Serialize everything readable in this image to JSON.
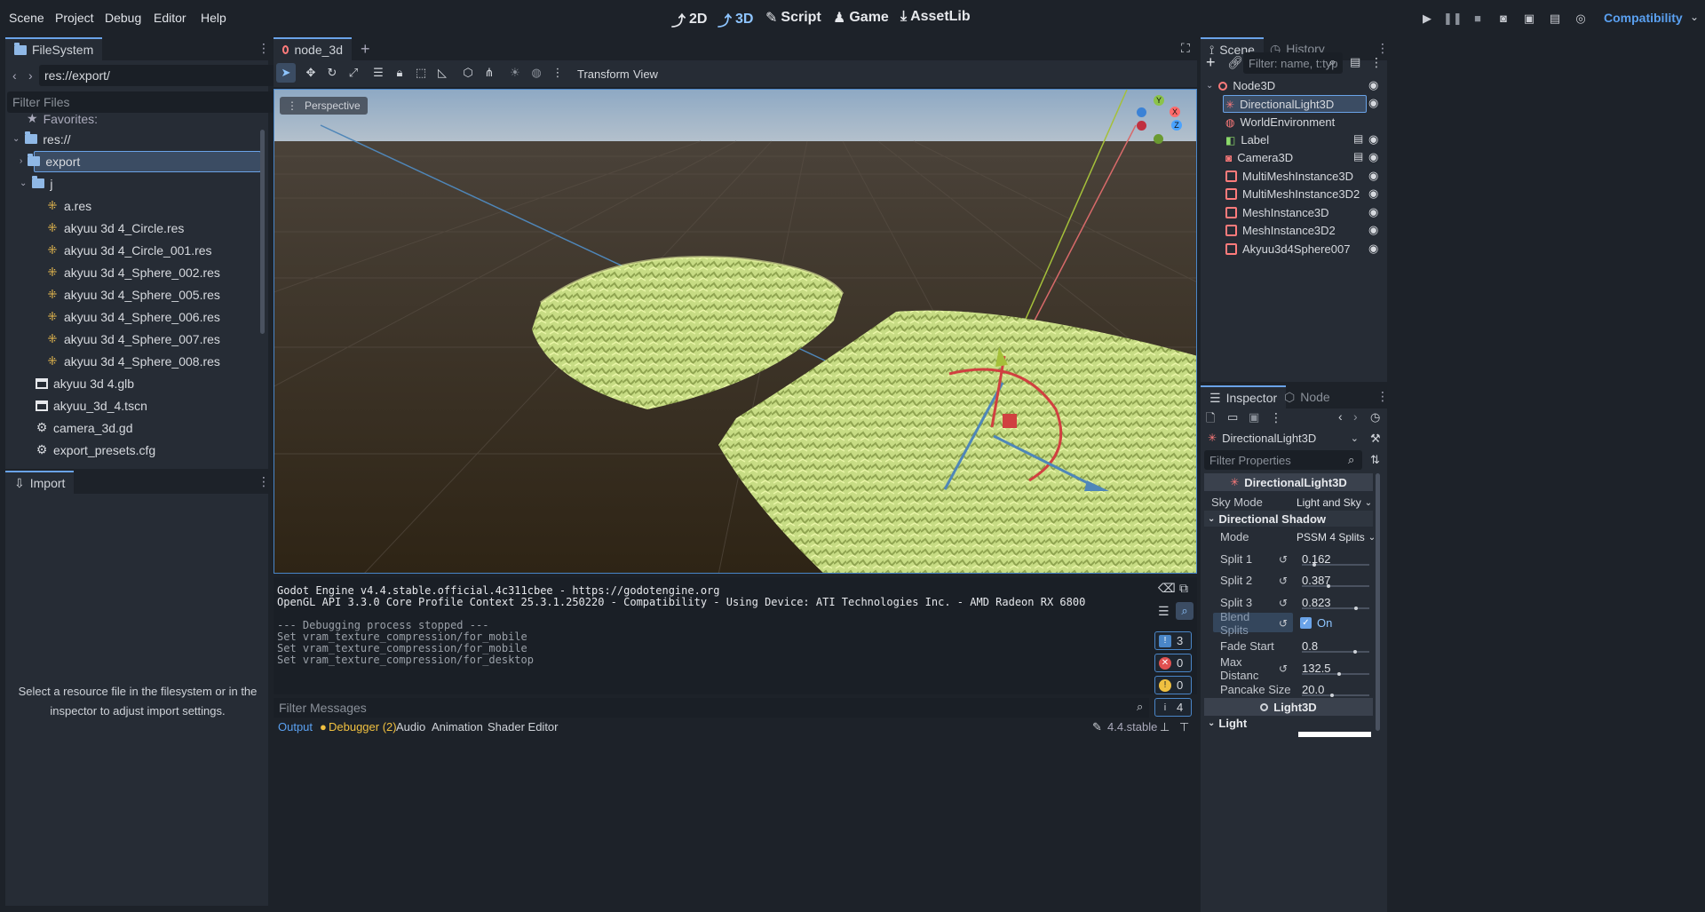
{
  "menu": {
    "scene": "Scene",
    "project": "Project",
    "debug": "Debug",
    "editor": "Editor",
    "help": "Help"
  },
  "workspaces": {
    "w2d": "2D",
    "w3d": "3D",
    "script": "Script",
    "game": "Game",
    "assetlib": "AssetLib"
  },
  "renderer": "Compatibility",
  "filesystem": {
    "tab": "FileSystem",
    "path": "res://export/",
    "filter_placeholder": "Filter Files",
    "favorites": "Favorites:",
    "items": [
      {
        "label": "res://",
        "kind": "folder"
      },
      {
        "label": "export",
        "kind": "folder"
      },
      {
        "label": "j",
        "kind": "folder"
      },
      {
        "label": "a.res",
        "kind": "res"
      },
      {
        "label": "akyuu 3d 4_Circle.res",
        "kind": "res"
      },
      {
        "label": "akyuu 3d 4_Circle_001.res",
        "kind": "res"
      },
      {
        "label": "akyuu 3d 4_Sphere_002.res",
        "kind": "res"
      },
      {
        "label": "akyuu 3d 4_Sphere_005.res",
        "kind": "res"
      },
      {
        "label": "akyuu 3d 4_Sphere_006.res",
        "kind": "res"
      },
      {
        "label": "akyuu 3d 4_Sphere_007.res",
        "kind": "res"
      },
      {
        "label": "akyuu 3d 4_Sphere_008.res",
        "kind": "res"
      },
      {
        "label": "akyuu 3d 4.glb",
        "kind": "scene"
      },
      {
        "label": "akyuu_3d_4.tscn",
        "kind": "scene"
      },
      {
        "label": "camera_3d.gd",
        "kind": "gear"
      },
      {
        "label": "export_presets.cfg",
        "kind": "gear"
      }
    ]
  },
  "import": {
    "tab": "Import",
    "message": "Select a resource file in the filesystem or in the inspector to adjust import settings."
  },
  "editor_tab": {
    "label": "node_3d"
  },
  "viewport": {
    "toolbar": {
      "transform": "Transform",
      "view": "View"
    },
    "perspective": "Perspective",
    "gizmo": {
      "x": "X",
      "y": "Y",
      "z": "Z"
    }
  },
  "output": {
    "lines": [
      "Godot Engine v4.4.stable.official.4c311cbee - https://godotengine.org",
      "OpenGL API 3.3.0 Core Profile Context 25.3.1.250220 - Compatibility - Using Device: ATI Technologies Inc. - AMD Radeon RX 6800",
      "",
      "--- Debugging process stopped ---",
      "Set vram_texture_compression/for_mobile",
      "Set vram_texture_compression/for_mobile",
      "Set vram_texture_compression/for_desktop"
    ],
    "filter_placeholder": "Filter Messages",
    "counts": {
      "messages": "3",
      "errors": "0",
      "warnings": "0",
      "info": "4"
    }
  },
  "bottom_tabs": {
    "output": "Output",
    "debugger": "Debugger (2)",
    "audio": "Audio",
    "animation": "Animation",
    "shader": "Shader Editor"
  },
  "version": "4.4.stable",
  "scene": {
    "tab": "Scene",
    "history_tab": "History",
    "filter_placeholder": "Filter: name, t:typ",
    "nodes": [
      {
        "label": "Node3D"
      },
      {
        "label": "DirectionalLight3D"
      },
      {
        "label": "WorldEnvironment"
      },
      {
        "label": "Label"
      },
      {
        "label": "Camera3D"
      },
      {
        "label": "MultiMeshInstance3D"
      },
      {
        "label": "MultiMeshInstance3D2"
      },
      {
        "label": "MeshInstance3D"
      },
      {
        "label": "MeshInstance3D2"
      },
      {
        "label": "Akyuu3d4Sphere007"
      }
    ]
  },
  "inspector": {
    "tab": "Inspector",
    "node_tab": "Node",
    "object": "DirectionalLight3D",
    "filter_placeholder": "Filter Properties",
    "section": "DirectionalLight3D",
    "sky_mode": {
      "label": "Sky Mode",
      "value": "Light and Sky"
    },
    "shadow_section": "Directional Shadow",
    "mode": {
      "label": "Mode",
      "value": "PSSM 4 Splits"
    },
    "split1": {
      "label": "Split 1",
      "value": "0.162",
      "fill": 0.162
    },
    "split2": {
      "label": "Split 2",
      "value": "0.387",
      "fill": 0.387
    },
    "split3": {
      "label": "Split 3",
      "value": "0.823",
      "fill": 0.823
    },
    "blend": {
      "label": "Blend Splits",
      "value": "On"
    },
    "fade": {
      "label": "Fade Start",
      "value": "0.8",
      "fill": 0.8
    },
    "maxdist": {
      "label": "Max Distanc",
      "value": "132.5",
      "fill": 0.55
    },
    "pancake": {
      "label": "Pancake Size",
      "value": "20.0",
      "fill": 0.45
    },
    "light_section": "Light3D",
    "light_group": "Light"
  }
}
